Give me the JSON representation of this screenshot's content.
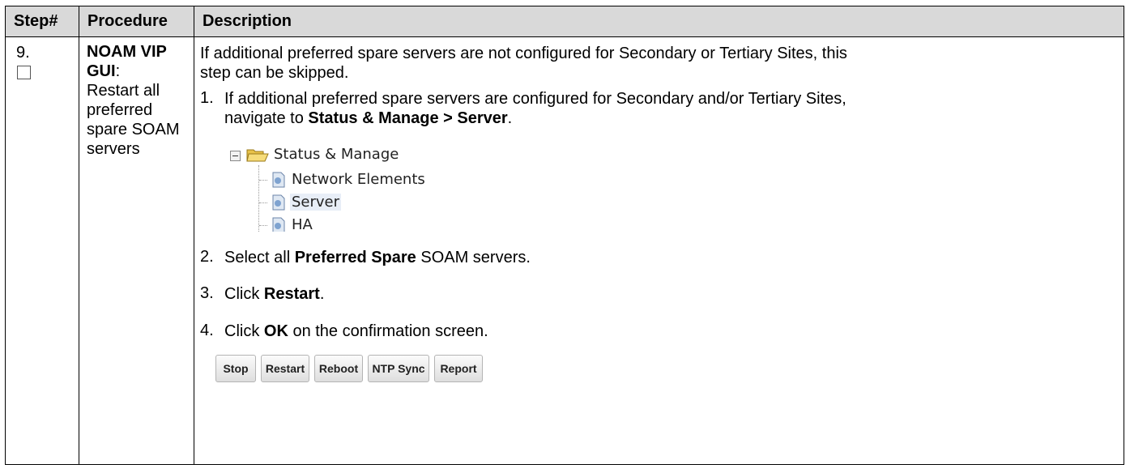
{
  "headers": {
    "step": "Step#",
    "procedure": "Procedure",
    "description": "Description"
  },
  "step": {
    "number": "9."
  },
  "procedure": {
    "bold_title": "NOAM VIP GUI",
    "colon": ":",
    "text": "Restart all preferred spare SOAM servers"
  },
  "description": {
    "intro_line1": "If additional preferred spare servers are not configured for Secondary or Tertiary Sites, this",
    "intro_line2": "step can be skipped.",
    "steps": [
      {
        "num": "1.",
        "line1": "If additional preferred spare servers are configured for Secondary and/or Tertiary Sites,",
        "line2_prefix": "navigate to ",
        "line2_bold": "Status & Manage > Server",
        "line2_suffix": "."
      },
      {
        "num": "2.",
        "prefix": "Select all ",
        "bold": "Preferred Spare",
        "suffix": " SOAM servers."
      },
      {
        "num": "3.",
        "prefix": "Click ",
        "bold": "Restart",
        "suffix": "."
      },
      {
        "num": "4.",
        "prefix": "Click ",
        "bold": "OK",
        "suffix": " on the confirmation screen."
      }
    ]
  },
  "nav_tree": {
    "root": "Status & Manage",
    "children": [
      "Network Elements",
      "Server",
      "HA"
    ],
    "selected": "Server"
  },
  "buttons": [
    "Stop",
    "Restart",
    "Reboot",
    "NTP Sync",
    "Report"
  ]
}
